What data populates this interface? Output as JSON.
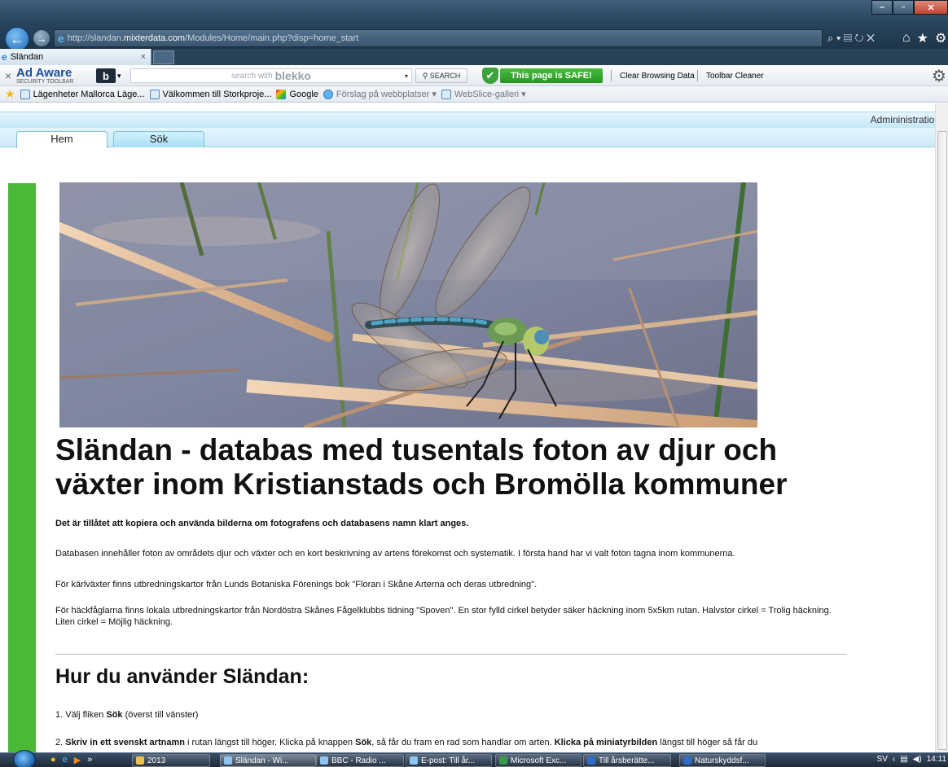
{
  "browser": {
    "url_prefix": "http://slandan.",
    "url_domain": "mixterdata.com",
    "url_path": "/Modules/Home/main.php?disp=home_start",
    "tab_title": "Sländan",
    "tab_close": "×",
    "addr_tools": "⌕ ▾ ▤ ↻ ✕"
  },
  "adaware_toolbar": {
    "close": "×",
    "logo_big_a": "Ad ",
    "logo_big_b": "Aware",
    "logo_small": "SECURITY TOOLBAR",
    "b_icon": "b",
    "b_arrow": "▾",
    "search_placeholder": "search with",
    "search_brand": "blekko",
    "search_dropdown": "▾",
    "search_button": "⚲ SEARCH",
    "safe_badge": "This page is SAFE!",
    "clear_browsing": "Clear Browsing Data",
    "toolbar_cleaner": "Toolbar Cleaner"
  },
  "favorites": [
    {
      "label": "Lägenheter Mallorca Läge...",
      "style": "page"
    },
    {
      "label": "Välkommen till Storkproje...",
      "style": "page"
    },
    {
      "label": "Google",
      "style": "google"
    },
    {
      "label": "Förslag på webbplatser ▾",
      "style": "ie"
    },
    {
      "label": "WebSlice-galleri ▾",
      "style": "page"
    }
  ],
  "page": {
    "admin_link": "Admininistration",
    "tabs": {
      "home": "Hem",
      "search": "Sök"
    },
    "headline": "Sländan - databas med tusentals foton av djur och växter inom Kristianstads och Bromölla kommuner",
    "permission": "Det är tillåtet att kopiera och använda bilderna om fotografens och databasens namn klart anges.",
    "database_desc": "Databasen innehåller foton av områdets djur och växter och en kort beskrivning av artens förekomst och systematik. I första hand har vi valt foton tagna inom kommunerna.",
    "vascular_desc": "För kärlväxter finns utbredningskartor från Lunds Botaniska Förenings bok \"Floran i Skåne  Arterna och deras utbredning\".",
    "birds_desc": "För häckfåglarna finns lokala utbredningskartor från Nordöstra Skånes Fågelklubbs tidning \"Spoven\". En stor fylld cirkel betyder säker häckning inom 5x5km rutan. Halvstor cirkel = Trolig häckning. Liten cirkel = Möjlig häckning.",
    "howto_heading": "Hur du använder Sländan:",
    "step1_a": "1. Välj fliken ",
    "step1_b": "Sök",
    "step1_c": " (överst till vänster)",
    "step2_a": "2. ",
    "step2_b": "Skriv in ett svenskt artnamn",
    "step2_c": " i rutan längst till höger. Klicka på knappen ",
    "step2_d": "Sök",
    "step2_e": ", så får du fram en rad som handlar om arten. ",
    "step2_f": "Klicka på miniatyrbilden",
    "step2_g": " längst till höger så får du"
  },
  "taskbar": {
    "quicklaunch": "»",
    "buttons": [
      {
        "label": "2013"
      },
      {
        "label": "Sländan - Wi..."
      },
      {
        "label": "BBC - Radio ..."
      },
      {
        "label": "E-post: Till år..."
      },
      {
        "label": "Microsoft Exc..."
      },
      {
        "label": "Till årsberätte..."
      },
      {
        "label": "Naturskyddsf..."
      }
    ],
    "lang": "SV",
    "time": "14:11"
  },
  "colors": {
    "green_bar": "#4cb838",
    "tab_band": "#cdeaf8",
    "safe_green": "#269624"
  }
}
